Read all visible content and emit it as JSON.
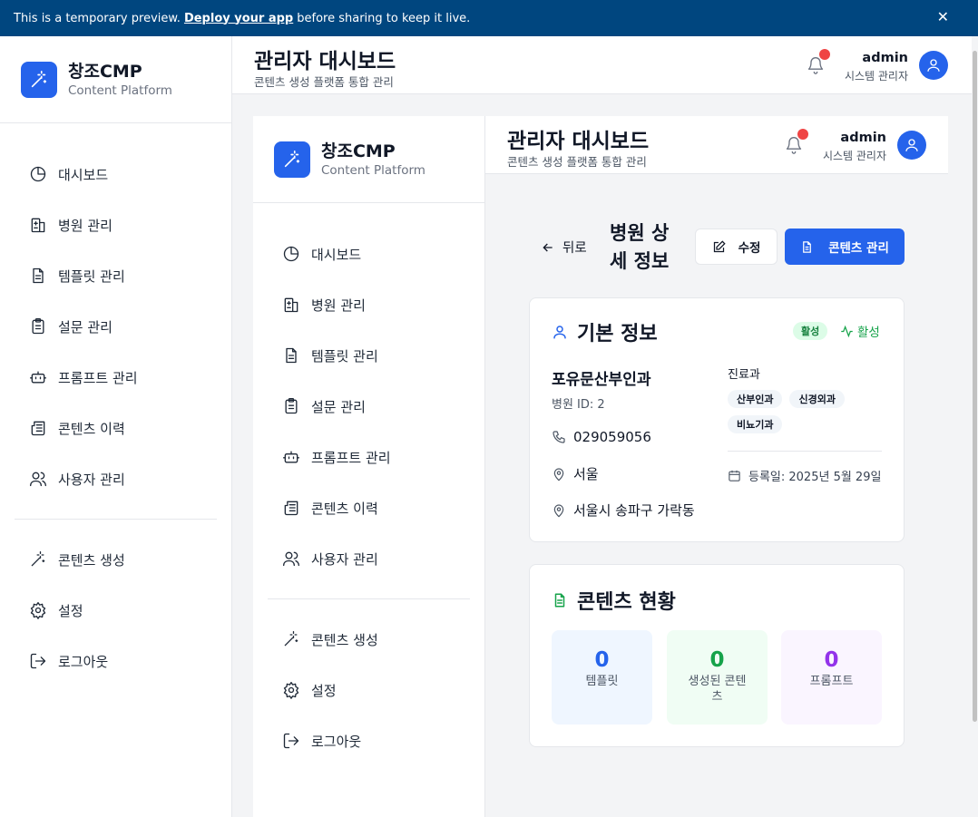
{
  "banner": {
    "text_before": "This is a temporary preview.",
    "link": "Deploy your app",
    "text_after": "before sharing to keep it live.",
    "close": "✕"
  },
  "brand": {
    "name": "창조CMP",
    "subtitle": "Content Platform"
  },
  "nav": {
    "items": [
      {
        "label": "대시보드",
        "icon": "pie-chart-icon"
      },
      {
        "label": "병원 관리",
        "icon": "hospital-icon"
      },
      {
        "label": "템플릿 관리",
        "icon": "file-text-icon"
      },
      {
        "label": "설문 관리",
        "icon": "clipboard-icon"
      },
      {
        "label": "프롬프트 관리",
        "icon": "bot-icon"
      },
      {
        "label": "콘텐츠 이력",
        "icon": "newspaper-icon"
      },
      {
        "label": "사용자 관리",
        "icon": "users-icon"
      }
    ],
    "bottom": [
      {
        "label": "콘텐츠 생성",
        "icon": "magic-wand-icon"
      },
      {
        "label": "설정",
        "icon": "gear-icon"
      },
      {
        "label": "로그아웃",
        "icon": "logout-icon"
      }
    ]
  },
  "header": {
    "title": "관리자 대시보드",
    "subtitle": "콘텐츠 생성 플랫폼 통합 관리",
    "user_name": "admin",
    "user_role": "시스템 관리자"
  },
  "detail": {
    "back_label": "뒤로",
    "title": "병원 상세 정보",
    "edit_label": "수정",
    "content_label": "콘텐츠 관리"
  },
  "basic_info": {
    "title": "기본 정보",
    "badge": "활성",
    "status": "활성",
    "hospital_name": "포유문산부인과",
    "hospital_id": "병원 ID: 2",
    "phone": "029059056",
    "region": "서울",
    "address": "서울시 송파구 가락동",
    "departments_label": "진료과",
    "departments": [
      "산부인과",
      "신경외과",
      "비뇨기과"
    ],
    "registered": "등록일: 2025년 5월 29일"
  },
  "content_status": {
    "title": "콘텐츠 현황",
    "stats": [
      {
        "value": "0",
        "label": "템플릿",
        "color": "#2563eb",
        "bg": "#eff6ff"
      },
      {
        "value": "0",
        "label": "생성된 콘텐츠",
        "color": "#16a34a",
        "bg": "#f0fdf4"
      },
      {
        "value": "0",
        "label": "프롬프트",
        "color": "#9333ea",
        "bg": "#faf5ff"
      }
    ]
  }
}
